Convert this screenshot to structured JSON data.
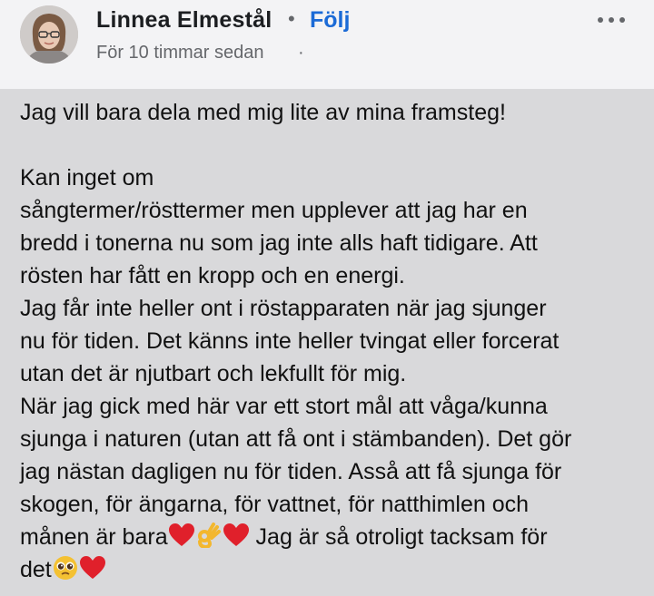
{
  "post": {
    "author_name": "Linnea Elmestål",
    "separator": "•",
    "follow_label": "Följ",
    "timestamp": "För 10 timmar sedan",
    "timestamp_separator": "·",
    "more_icon": "more-horizontal-icon"
  },
  "body": {
    "lines": [
      "Jag vill bara dela med mig lite av mina framsteg!",
      "",
      "Kan inget om",
      "sångtermer/rösttermer men upplever att jag har en",
      "bredd i tonerna nu som jag inte alls haft tidigare. Att",
      "rösten har fått en kropp och en energi.",
      "Jag får inte heller ont i röstapparaten när jag sjunger",
      "nu för tiden. Det känns inte heller tvingat eller forcerat",
      "utan det är njutbart och lekfullt för mig.",
      "När jag gick med här var ett stort mål att våga/kunna",
      "sjunga i naturen (utan att få ont i stämbanden). Det gör",
      "jag nästan dagligen nu för tiden. Asså att få sjunga för",
      "skogen, för ängarna, för  vattnet, för natthimlen och"
    ],
    "line14_a": "månen är bara",
    "line14_b": " Jag är så otroligt tacksam för",
    "line15_a": "det",
    "emojis": [
      "red-heart-emoji",
      "ok-hand-emoji",
      "pleading-face-emoji"
    ],
    "colors": {
      "heart": "#e0202b",
      "ok_hand": "#f3b72e",
      "face": "#f4c132"
    }
  },
  "colors": {
    "header_bg": "#f3f3f5",
    "body_bg": "#d9d9db",
    "link_blue": "#1b6ad6",
    "secondary_text": "#65676b"
  }
}
